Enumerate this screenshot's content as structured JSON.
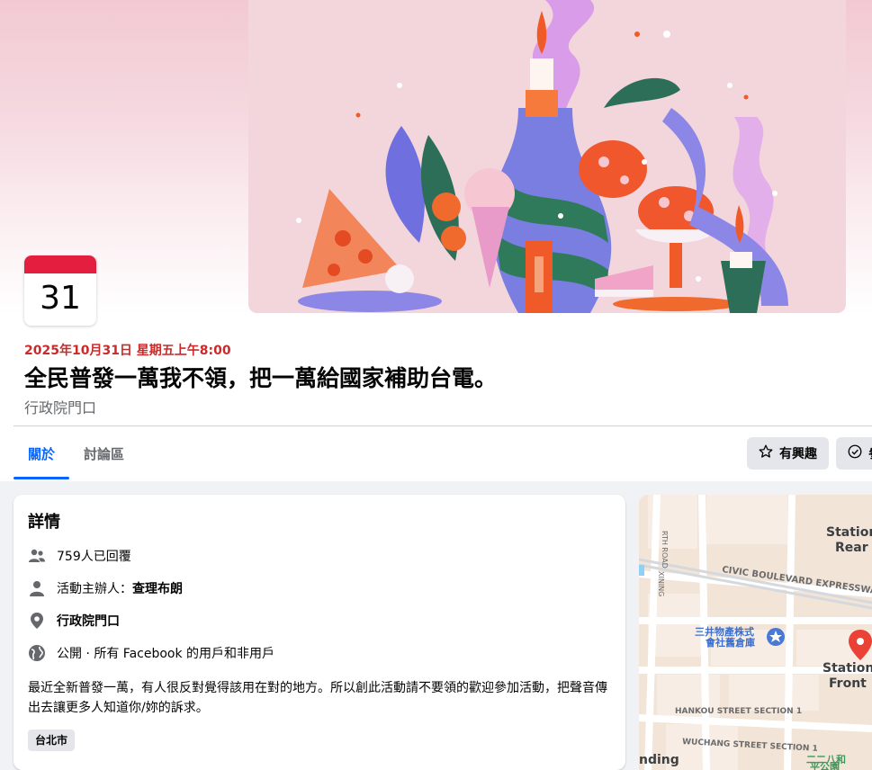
{
  "event": {
    "calendar_day": "31日",
    "date_time": "2025年10月31日 星期五上午8:00",
    "title": "全民普發一萬我不領，把一萬給國家補助台電。",
    "location": "行政院門口"
  },
  "tabs": [
    {
      "label": "關於",
      "active": true
    },
    {
      "label": "討論區",
      "active": false
    }
  ],
  "actions": {
    "interested_label": "有興趣",
    "going_label": "參"
  },
  "details": {
    "heading": "詳情",
    "responded": "759人已回覆",
    "organizer_prefix": "活動主辦人：",
    "organizer_name": "查理布朗",
    "location": "行政院門口",
    "privacy": "公開 · 所有 Facebook 的用戶和非用戶",
    "description": "最近全新普發一萬，有人很反對覺得該用在對的地方。所以創此活動請不要領的歡迎參加活動，把聲音傳出去讓更多人知道你/妳的訴求。",
    "tag": "台北市"
  },
  "map": {
    "labels": {
      "station_rear": "Station Rear",
      "station_front": "Station Front",
      "civic_blvd": "CIVIC BOULEVARD EXPRESSWAY",
      "mitsui": "三井物產株式會社舊倉庫",
      "hankou": "HANKOU STREET SECTION 1",
      "wuchang": "WUCHANG STREET SECTION 1",
      "xining": "XINING",
      "rth_road": "RTH ROAD",
      "ending": "nding",
      "park": "二二八和平公園"
    }
  },
  "colors": {
    "accent": "#0866ff",
    "date_red": "#c92a2a",
    "calendar_red": "#e41e3f",
    "map_pin": "#ea4335"
  }
}
